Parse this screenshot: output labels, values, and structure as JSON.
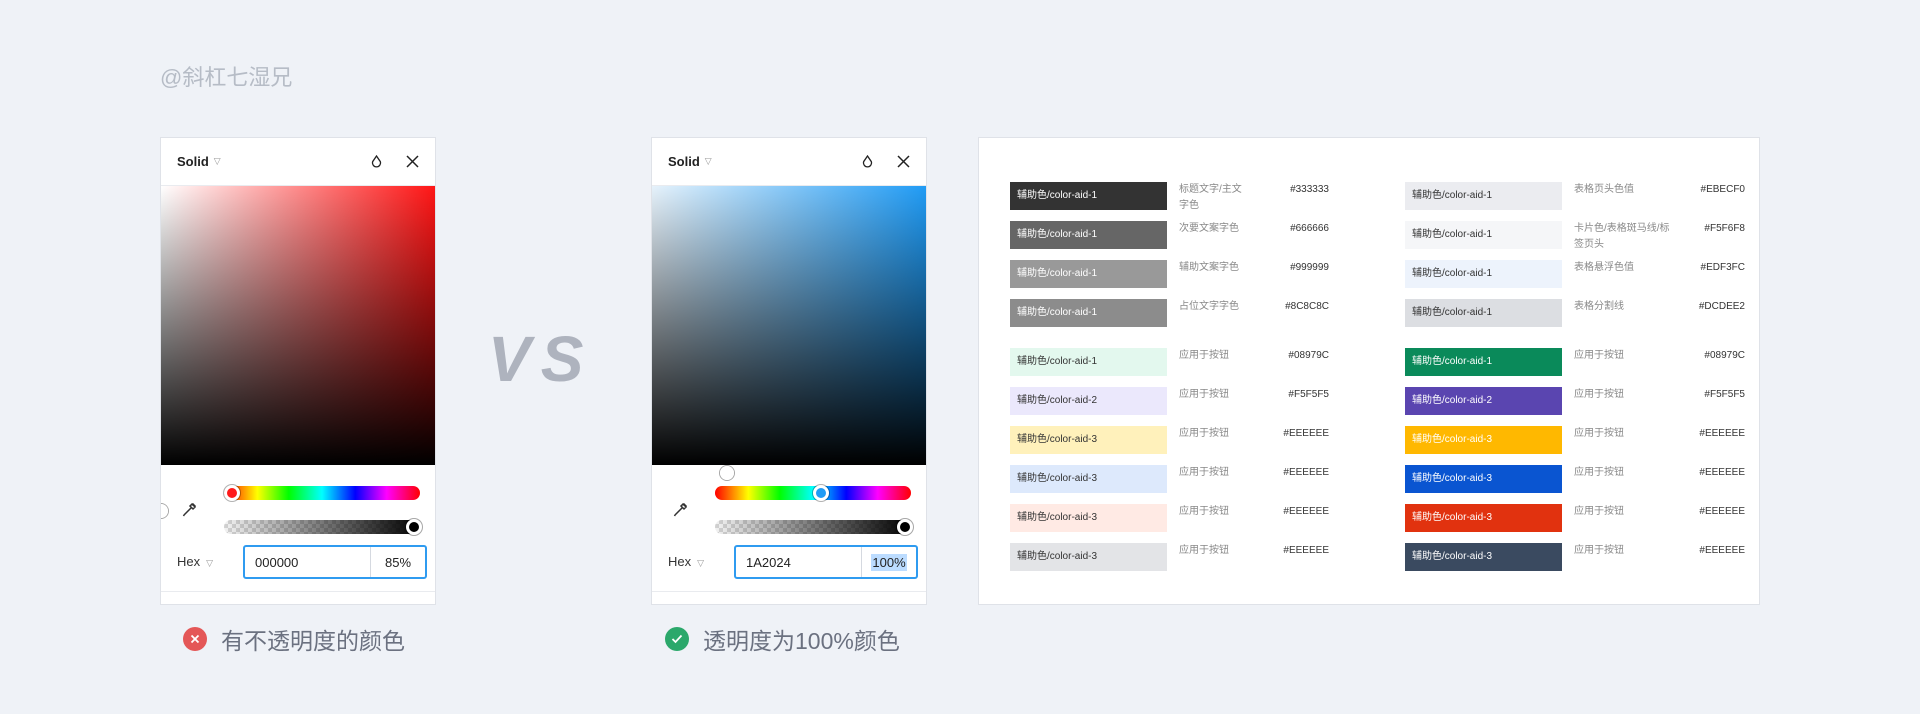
{
  "watermark": "@斜杠七湿兄",
  "vs_text": "VS",
  "pickers": [
    {
      "mode": "Solid",
      "format": "Hex",
      "hex": "000000",
      "alpha": "85%",
      "verdict": "有不透明度的颜色",
      "verdict_status": "error"
    },
    {
      "mode": "Solid",
      "format": "Hex",
      "hex": "1A2024",
      "alpha": "100%",
      "verdict": "透明度为100%颜色",
      "verdict_status": "success"
    }
  ],
  "colors": {
    "picker_accent": "#2f9bf0",
    "error": "#e45757",
    "success": "#2ba86b"
  },
  "tokens": {
    "left": [
      {
        "label": "辅助色/color-aid-1",
        "desc": "标题文字/主文字色",
        "hex": "#333333",
        "bg": "#333333",
        "fg": "#ffffff"
      },
      {
        "label": "辅助色/color-aid-1",
        "desc": "次要文案字色",
        "hex": "#666666",
        "bg": "#666666",
        "fg": "#ffffff"
      },
      {
        "label": "辅助色/color-aid-1",
        "desc": "辅助文案字色",
        "hex": "#999999",
        "bg": "#999999",
        "fg": "#ffffff"
      },
      {
        "label": "辅助色/color-aid-1",
        "desc": "占位文字字色",
        "hex": "#8C8C8C",
        "bg": "#8c8c8c",
        "fg": "#ffffff"
      },
      {
        "label": "辅助色/color-aid-1",
        "desc": "应用于按钮",
        "hex": "#08979C",
        "bg": "#e3f8ee",
        "fg": "#333333"
      },
      {
        "label": "辅助色/color-aid-2",
        "desc": "应用于按钮",
        "hex": "#F5F5F5",
        "bg": "#ebe8fc",
        "fg": "#333333"
      },
      {
        "label": "辅助色/color-aid-3",
        "desc": "应用于按钮",
        "hex": "#EEEEEE",
        "bg": "#fff1bb",
        "fg": "#333333"
      },
      {
        "label": "辅助色/color-aid-3",
        "desc": "应用于按钮",
        "hex": "#EEEEEE",
        "bg": "#dde9fc",
        "fg": "#333333"
      },
      {
        "label": "辅助色/color-aid-3",
        "desc": "应用于按钮",
        "hex": "#EEEEEE",
        "bg": "#ffeae4",
        "fg": "#333333"
      },
      {
        "label": "辅助色/color-aid-3",
        "desc": "应用于按钮",
        "hex": "#EEEEEE",
        "bg": "#e3e4e7",
        "fg": "#333333"
      }
    ],
    "right": [
      {
        "label": "辅助色/color-aid-1",
        "desc": "表格页头色值",
        "hex": "#EBECF0",
        "bg": "#ebecf0",
        "fg": "#333333"
      },
      {
        "label": "辅助色/color-aid-1",
        "desc": "卡片色/表格斑马线/标签页头",
        "hex": "#F5F6F8",
        "bg": "#f5f6f8",
        "fg": "#333333"
      },
      {
        "label": "辅助色/color-aid-1",
        "desc": "表格悬浮色值",
        "hex": "#EDF3FC",
        "bg": "#edf3fc",
        "fg": "#333333"
      },
      {
        "label": "辅助色/color-aid-1",
        "desc": "表格分割线",
        "hex": "#DCDEE2",
        "bg": "#dcdee2",
        "fg": "#333333"
      },
      {
        "label": "辅助色/color-aid-1",
        "desc": "应用于按钮",
        "hex": "#08979C",
        "bg": "#0a8a5a",
        "fg": "#ffffff"
      },
      {
        "label": "辅助色/color-aid-2",
        "desc": "应用于按钮",
        "hex": "#F5F5F5",
        "bg": "#5a45b0",
        "fg": "#ffffff"
      },
      {
        "label": "辅助色/color-aid-3",
        "desc": "应用于按钮",
        "hex": "#EEEEEE",
        "bg": "#ffb800",
        "fg": "#ffffff"
      },
      {
        "label": "辅助色/color-aid-3",
        "desc": "应用于按钮",
        "hex": "#EEEEEE",
        "bg": "#0a55d1",
        "fg": "#ffffff"
      },
      {
        "label": "辅助色/color-aid-3",
        "desc": "应用于按钮",
        "hex": "#EEEEEE",
        "bg": "#e1320f",
        "fg": "#ffffff"
      },
      {
        "label": "辅助色/color-aid-3",
        "desc": "应用于按钮",
        "hex": "#EEEEEE",
        "bg": "#3a4a60",
        "fg": "#ffffff"
      }
    ]
  }
}
